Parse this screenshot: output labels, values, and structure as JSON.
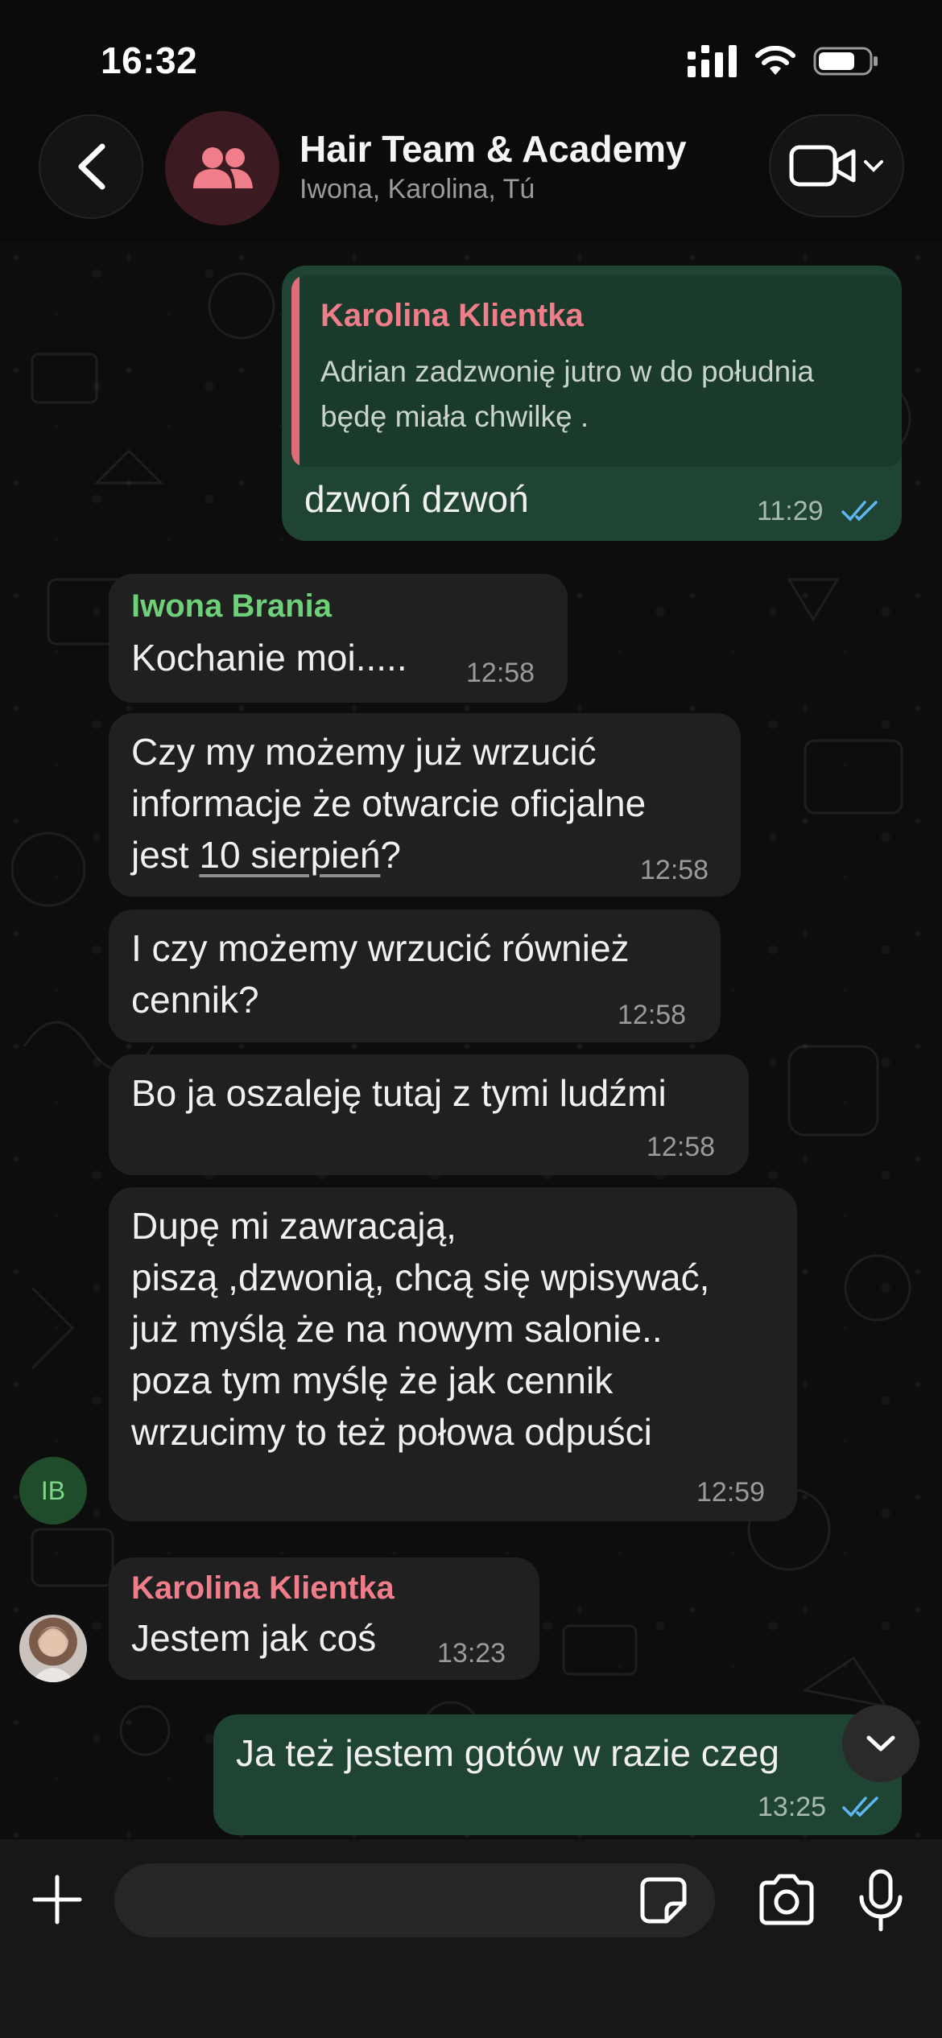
{
  "status": {
    "time": "16:32"
  },
  "header": {
    "group_name": "Hair Team & Academy",
    "members": "Iwona, Karolina, Tú"
  },
  "messages": [
    {
      "direction": "outgoing",
      "quote_sender": "Karolina Klientka",
      "quote_text": "Adrian zadzwonię jutro w do południa\nbędę miała chwilkę .",
      "text": "dzwoń dzwoń",
      "time": "11:29"
    },
    {
      "direction": "incoming",
      "sender": "Iwona Brania",
      "text": "Kochanie moi.....",
      "time": "12:58"
    },
    {
      "direction": "incoming",
      "text_before_link": "Czy my możemy już wrzucić\ninformacje że otwarcie oficjalne\njest ",
      "link_text": "10 sierpień",
      "text_after_link": "?",
      "time": "12:58"
    },
    {
      "direction": "incoming",
      "text": "I czy możemy wrzucić również\ncennik?",
      "time": "12:58"
    },
    {
      "direction": "incoming",
      "text": "Bo ja oszaleję tutaj z tymi ludźmi",
      "time": "12:58"
    },
    {
      "direction": "incoming",
      "text": "Dupę mi zawracają,\npiszą ,dzwonią, chcą się wpisywać,\njuż myślą że na nowym salonie..\npoza tym myślę że jak cennik\nwrzucimy to też połowa odpuści",
      "time": "12:59",
      "avatar_initials": "IB"
    },
    {
      "direction": "incoming",
      "sender": "Karolina Klientka",
      "text": "Jestem jak coś",
      "time": "13:23"
    },
    {
      "direction": "outgoing",
      "text": "Ja też jestem gotów w razie czeg",
      "time": "13:25"
    }
  ],
  "colors": {
    "sender_iwona": "#6fd07a",
    "sender_karolina": "#f07d8a",
    "outgoing_bubble": "#1f4433",
    "incoming_bubble": "#202020",
    "read_ticks": "#5eb6f0"
  },
  "icons": {
    "back": "chevron-left-icon",
    "group": "people-icon",
    "video": "video-camera-icon",
    "scroll": "chevron-down-icon",
    "plus": "plus-icon",
    "sticker": "sticker-icon",
    "camera": "camera-icon",
    "mic": "microphone-icon"
  }
}
